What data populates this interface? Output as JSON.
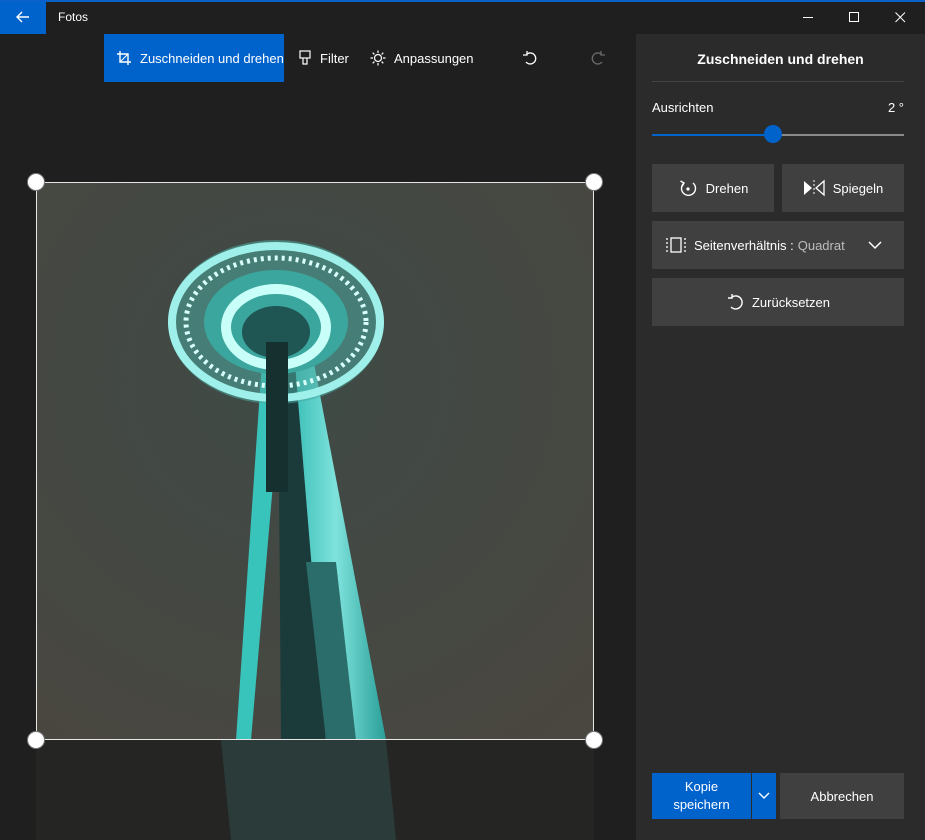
{
  "window": {
    "title": "Fotos"
  },
  "toolbar": {
    "crop_rotate": "Zuschneiden und drehen",
    "filter": "Filter",
    "adjust": "Anpassungen"
  },
  "panel": {
    "title": "Zuschneiden und drehen",
    "straighten_label": "Ausrichten",
    "straighten_value": "2 °",
    "straighten_fraction": 0.48,
    "rotate_label": "Drehen",
    "flip_label": "Spiegeln",
    "aspect_label": "Seitenverhältnis :",
    "aspect_value": "Quadrat",
    "reset_label": "Zurücksetzen",
    "save_copy_line1": "Kopie",
    "save_copy_line2": "speichern",
    "cancel_label": "Abbrechen"
  },
  "colors": {
    "accent": "#0063cc",
    "panel_bg": "#2b2b2b",
    "button_bg": "#404040",
    "window_bg": "#1f1f1f"
  }
}
